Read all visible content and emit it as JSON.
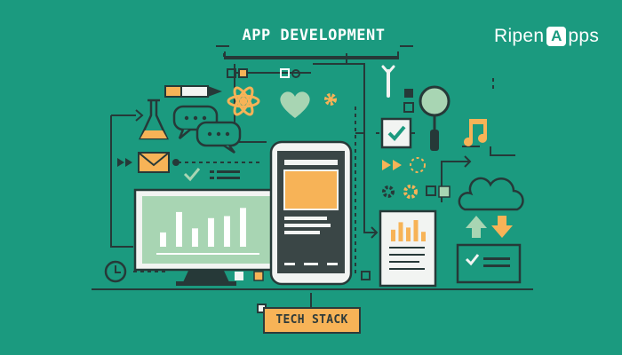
{
  "header": {
    "title": "APP DEVELOPMENT"
  },
  "logo": {
    "text_before": "Ripen",
    "letter_badge": "A",
    "text_after": "pps"
  },
  "footer": {
    "label": "TECH STACK"
  },
  "colors": {
    "background": "#1b9a7f",
    "dark": "#2d3a3a",
    "line": "#263938",
    "orange": "#f7b357",
    "light_green": "#a8d5b3",
    "white": "#ffffff",
    "paper": "#f2f4f2"
  },
  "monitor_chart": {
    "bar_levels": [
      0.35,
      0.85,
      0.45,
      0.7,
      0.75,
      0.95
    ]
  },
  "document_chart": {
    "bar_levels": [
      0.55,
      0.9,
      0.65,
      1.0,
      0.45
    ]
  },
  "icons": [
    "flask-icon",
    "chat-bubbles-icon",
    "pencil-icon",
    "atom-icon",
    "heart-icon",
    "gear-icon",
    "wrench-icon",
    "magnifier-icon",
    "checkbox-icon",
    "music-note-icon",
    "envelope-icon",
    "fast-forward-icon",
    "cloud-icon",
    "upload-arrow-icon",
    "download-arrow-icon",
    "clock-icon",
    "smartphone-icon",
    "monitor-icon",
    "document-chart-icon",
    "checklist-icon"
  ]
}
